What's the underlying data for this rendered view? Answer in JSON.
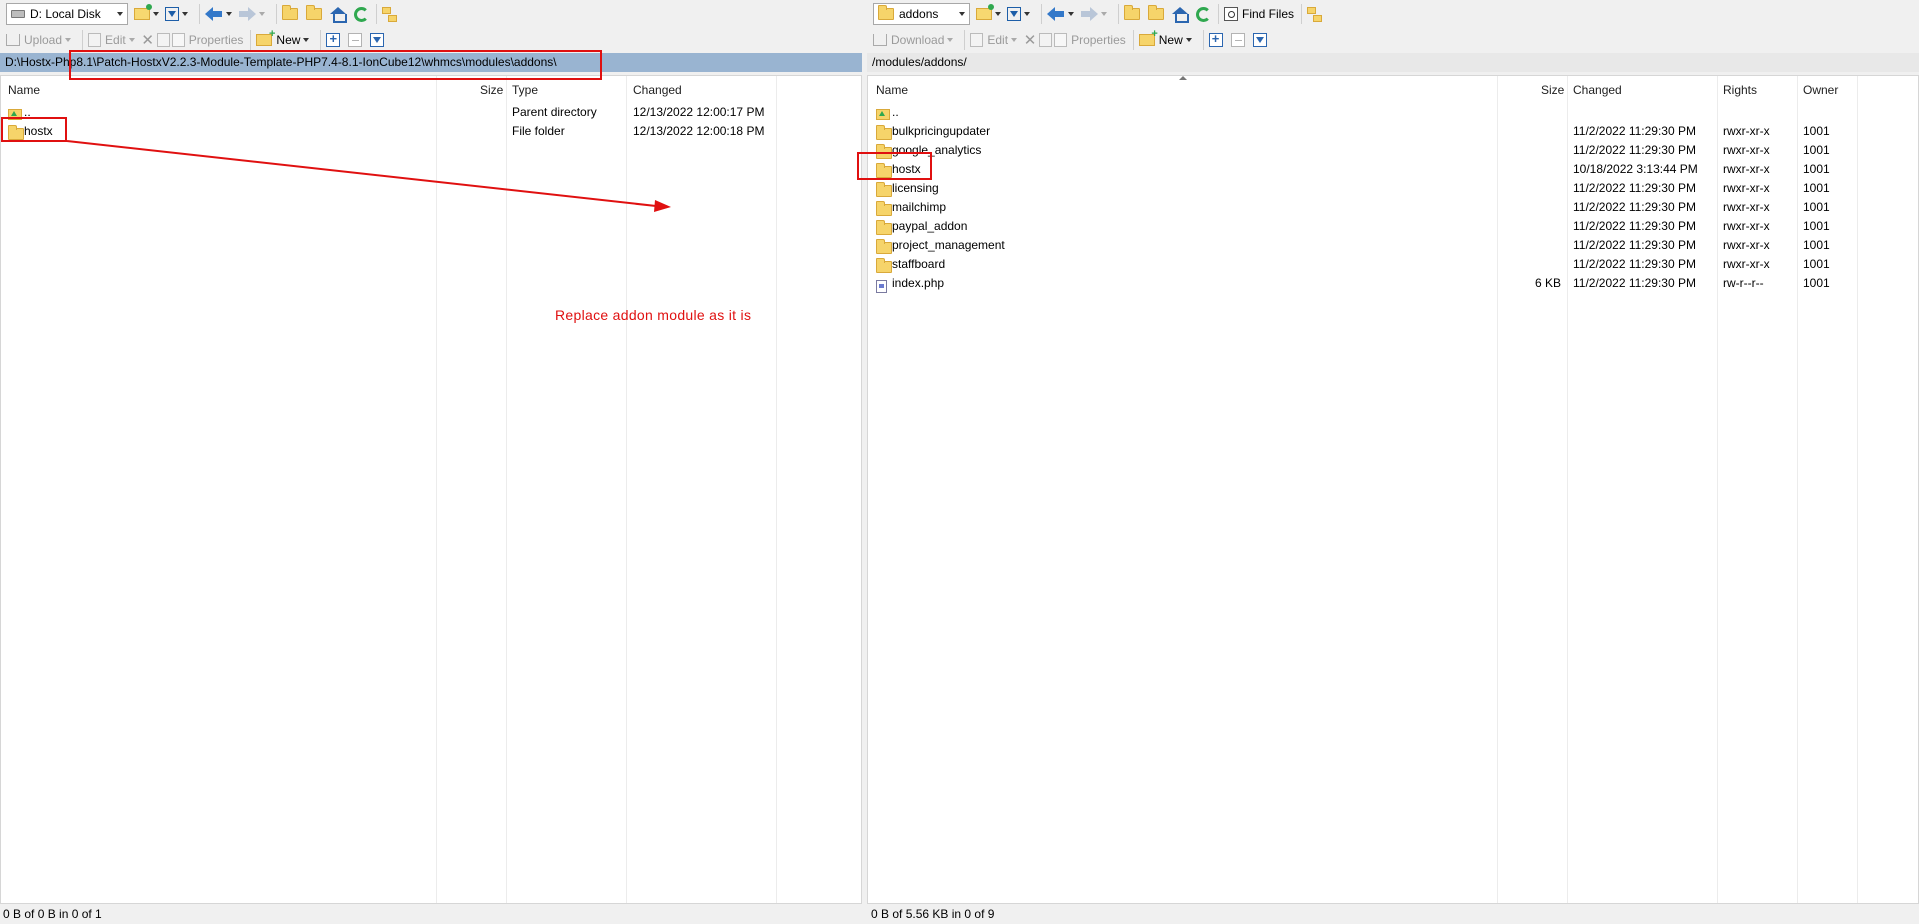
{
  "left": {
    "drive": {
      "label": "D: Local Disk",
      "icon": "drive-icon"
    },
    "toolbar2": {
      "upload": "Upload",
      "edit": "Edit",
      "properties": "Properties",
      "new": "New"
    },
    "path": "D:\\Hostx-Php8.1\\Patch-HostxV2.2.3-Module-Template-PHP7.4-8.1-IonCube12\\whmcs\\modules\\addons\\",
    "columns": {
      "name": "Name",
      "size": "Size",
      "type": "Type",
      "changed": "Changed"
    },
    "rows": [
      {
        "name": "..",
        "size": "",
        "type": "Parent directory",
        "changed": "12/13/2022  12:00:17 PM",
        "icon": "parent-dir-icon"
      },
      {
        "name": "hostx",
        "size": "",
        "type": "File folder",
        "changed": "12/13/2022  12:00:18 PM",
        "icon": "folder-icon"
      }
    ],
    "status": "0 B of 0 B in 0 of 1"
  },
  "right": {
    "dir": {
      "label": "addons",
      "icon": "folder-icon"
    },
    "toolbar1": {
      "find_files": "Find Files"
    },
    "toolbar2": {
      "download": "Download",
      "edit": "Edit",
      "properties": "Properties",
      "new": "New"
    },
    "path": "/modules/addons/",
    "columns": {
      "name": "Name",
      "size": "Size",
      "changed": "Changed",
      "rights": "Rights",
      "owner": "Owner"
    },
    "rows": [
      {
        "name": "..",
        "size": "",
        "changed": "",
        "rights": "",
        "owner": "",
        "icon": "parent-dir-icon"
      },
      {
        "name": "bulkpricingupdater",
        "size": "",
        "changed": "11/2/2022 11:29:30 PM",
        "rights": "rwxr-xr-x",
        "owner": "1001",
        "icon": "folder-icon"
      },
      {
        "name": "google_analytics",
        "size": "",
        "changed": "11/2/2022 11:29:30 PM",
        "rights": "rwxr-xr-x",
        "owner": "1001",
        "icon": "folder-icon"
      },
      {
        "name": "hostx",
        "size": "",
        "changed": "10/18/2022 3:13:44 PM",
        "rights": "rwxr-xr-x",
        "owner": "1001",
        "icon": "folder-icon"
      },
      {
        "name": "licensing",
        "size": "",
        "changed": "11/2/2022 11:29:30 PM",
        "rights": "rwxr-xr-x",
        "owner": "1001",
        "icon": "folder-icon"
      },
      {
        "name": "mailchimp",
        "size": "",
        "changed": "11/2/2022 11:29:30 PM",
        "rights": "rwxr-xr-x",
        "owner": "1001",
        "icon": "folder-icon"
      },
      {
        "name": "paypal_addon",
        "size": "",
        "changed": "11/2/2022 11:29:30 PM",
        "rights": "rwxr-xr-x",
        "owner": "1001",
        "icon": "folder-icon"
      },
      {
        "name": "project_management",
        "size": "",
        "changed": "11/2/2022 11:29:30 PM",
        "rights": "rwxr-xr-x",
        "owner": "1001",
        "icon": "folder-icon"
      },
      {
        "name": "staffboard",
        "size": "",
        "changed": "11/2/2022 11:29:30 PM",
        "rights": "rwxr-xr-x",
        "owner": "1001",
        "icon": "folder-icon"
      },
      {
        "name": "index.php",
        "size": "6 KB",
        "changed": "11/2/2022 11:29:30 PM",
        "rights": "rw-r--r--",
        "owner": "1001",
        "icon": "php-file-icon"
      }
    ],
    "status": "0 B of 5.56 KB in 0 of 9"
  },
  "annotation": {
    "text": "Replace addon module as it is",
    "color": "#e01010"
  },
  "colors": {
    "left_path_bg": "#99b4d1",
    "right_path_bg": "#e8e8e8",
    "folder": "#f6d46a"
  }
}
